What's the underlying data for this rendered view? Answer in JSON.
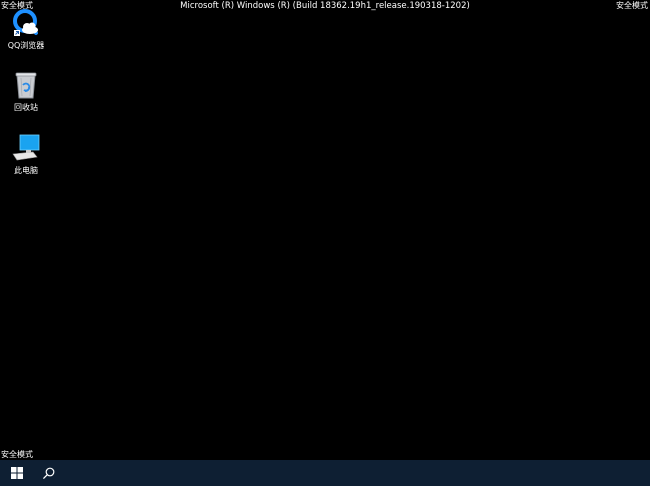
{
  "screen": {
    "safe_mode_label": "安全模式",
    "build_title": "Microsoft (R) Windows (R) (Build 18362.19h1_release.190318-1202)"
  },
  "desktop_icons": [
    {
      "label": "QQ浏览器",
      "icon": "qq-browser-icon"
    },
    {
      "label": "回收站",
      "icon": "recycle-bin-icon"
    },
    {
      "label": "此电脑",
      "icon": "this-pc-icon"
    }
  ],
  "taskbar": {
    "start_icon": "windows-logo-icon",
    "search_icon": "search-icon"
  },
  "colors": {
    "desktop_background": "#000000",
    "taskbar_background": "#0e1f33",
    "text": "#ffffff",
    "accent_blue": "#1e90ff"
  }
}
